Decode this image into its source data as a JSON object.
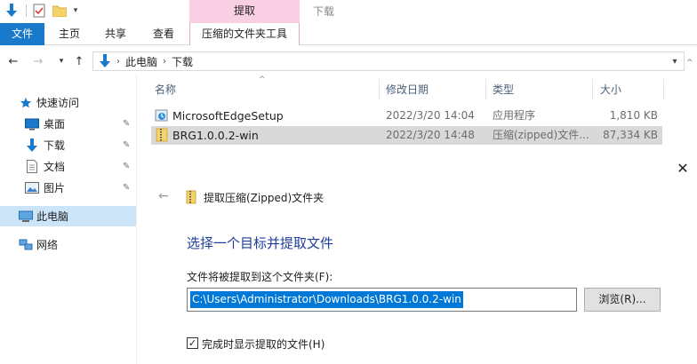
{
  "titlebar": {
    "context_group": "提取",
    "window_title": "下载"
  },
  "ribbon": {
    "tabs": [
      "文件",
      "主页",
      "共享",
      "查看"
    ],
    "context_tab": "压缩的文件夹工具"
  },
  "address": {
    "crumbs": [
      "此电脑",
      "下载"
    ]
  },
  "sidebar": {
    "items": [
      {
        "label": "快速访问",
        "icon": "star-icon"
      },
      {
        "label": "桌面",
        "icon": "desktop-icon",
        "pinned": true
      },
      {
        "label": "下载",
        "icon": "download-icon",
        "pinned": true
      },
      {
        "label": "文档",
        "icon": "document-icon",
        "pinned": true
      },
      {
        "label": "图片",
        "icon": "picture-icon",
        "pinned": true
      },
      {
        "label": "此电脑",
        "icon": "computer-icon",
        "selected": true
      },
      {
        "label": "网络",
        "icon": "network-icon"
      }
    ]
  },
  "columns": {
    "name": "名称",
    "date": "修改日期",
    "type": "类型",
    "size": "大小"
  },
  "files": [
    {
      "name": "MicrosoftEdgeSetup",
      "date": "2022/3/20 14:04",
      "type": "应用程序",
      "size": "1,810 KB",
      "icon": "installer-icon"
    },
    {
      "name": "BRG1.0.0.2-win",
      "date": "2022/3/20 14:48",
      "type": "压缩(zipped)文件...",
      "size": "87,334 KB",
      "icon": "zip-folder-icon",
      "selected": true
    }
  ],
  "wizard": {
    "title": "提取压缩(Zipped)文件夹",
    "heading": "选择一个目标并提取文件",
    "field_label": "文件将被提取到这个文件夹(F):",
    "path_value": "C:\\Users\\Administrator\\Downloads\\BRG1.0.0.2-win",
    "browse_label": "浏览(R)...",
    "checkbox_label": "完成时显示提取的文件(H)",
    "checkbox_checked": true
  },
  "colors": {
    "accent": "#1979ca",
    "context_tab": "#f9cfe3",
    "heading": "#1f3d99",
    "selection": "#0078d7"
  }
}
